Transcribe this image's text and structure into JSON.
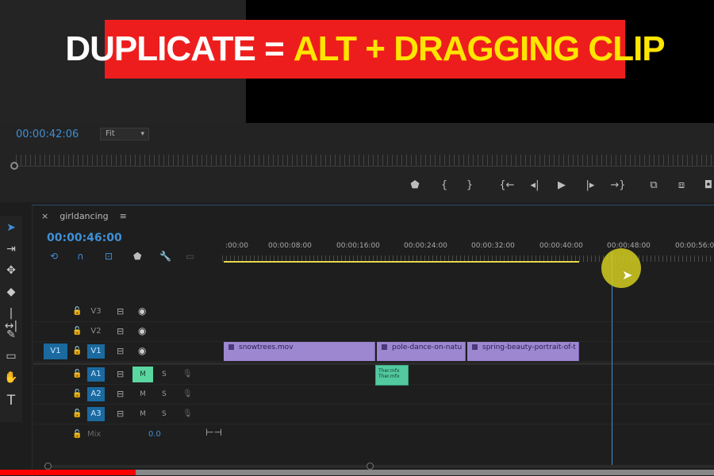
{
  "banner": {
    "part1": "DUPLICATE =",
    "part2": "ALT + DRAGGING CLIP"
  },
  "program_monitor": {
    "timecode": "00:00:42:06",
    "zoom": "Fit",
    "transport_icons": [
      "marker-icon",
      "mark-in-icon",
      "mark-out-icon",
      "go-to-in-icon",
      "step-back-icon",
      "play-icon",
      "step-forward-icon",
      "go-to-out-icon",
      "lift-icon",
      "extract-icon",
      "export-frame-icon"
    ]
  },
  "timeline": {
    "sequence_name": "girldancing",
    "timecode": "00:00:46:00",
    "ruler_labels": [
      ":00:00",
      "00:00:08:00",
      "00:00:16:00",
      "00:00:24:00",
      "00:00:32:00",
      "00:00:40:00",
      "00:00:48:00",
      "00:00:56:0"
    ],
    "tracks": {
      "video": [
        {
          "name": "V3"
        },
        {
          "name": "V2"
        },
        {
          "name": "V1",
          "source": "V1"
        }
      ],
      "audio": [
        {
          "name": "A1",
          "mute": "M",
          "solo": "S",
          "mute_on": true
        },
        {
          "name": "A2",
          "mute": "M",
          "solo": "S",
          "mute_on": false
        },
        {
          "name": "A3",
          "mute": "M",
          "solo": "S",
          "mute_on": false
        }
      ],
      "mix": {
        "label": "Mix",
        "value": "0.0"
      }
    },
    "video_clips": [
      "snowtrees.mov",
      "pole-dance-on-natu",
      "spring-beauty-portrait-of-t"
    ],
    "audio_clip_label": "Ther.mfx Ther.mfx"
  },
  "progress": {
    "watched_fraction": 0.19
  },
  "colors": {
    "accent_blue": "#3f8fd6",
    "banner_red": "#ee1d1d",
    "banner_yellow": "#ffe500",
    "clip_video": "#9c87d0",
    "clip_audio": "#53c9a0"
  }
}
